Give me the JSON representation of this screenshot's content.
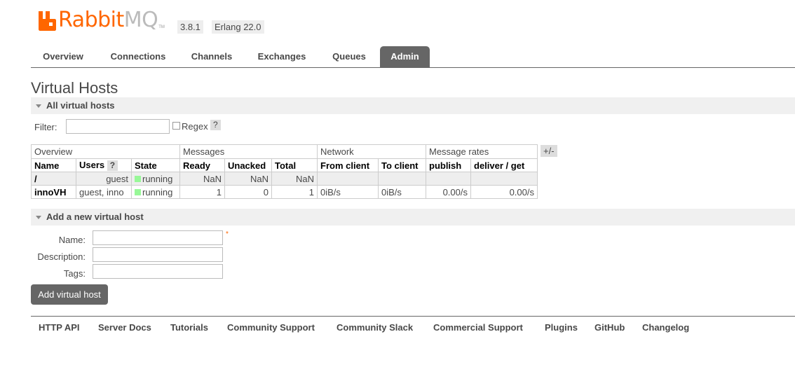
{
  "header": {
    "logo_text_primary": "Rabbit",
    "logo_text_secondary": "MQ",
    "logo_tm": "TM",
    "version": "3.8.1",
    "erlang": "Erlang 22.0",
    "brand_color": "#ff6600"
  },
  "tabs": [
    "Overview",
    "Connections",
    "Channels",
    "Exchanges",
    "Queues",
    "Admin"
  ],
  "active_tab": "Admin",
  "page_title": "Virtual Hosts",
  "all_vhosts": {
    "title": "All virtual hosts",
    "filter_label": "Filter:",
    "filter_value": "",
    "regex_label": "Regex",
    "help": "?"
  },
  "table": {
    "groups": [
      "Overview",
      "Messages",
      "Network",
      "Message rates"
    ],
    "columns": [
      "Name",
      "Users",
      "State",
      "Ready",
      "Unacked",
      "Total",
      "From client",
      "To client",
      "publish",
      "deliver / get"
    ],
    "users_help": "?",
    "plus_minus": "+/-",
    "rows": [
      {
        "name": "/",
        "users": "guest",
        "state": "running",
        "ready": "NaN",
        "unacked": "NaN",
        "total": "NaN",
        "from_client": "",
        "to_client": "",
        "publish": "",
        "deliver_get": ""
      },
      {
        "name": "innoVH",
        "users": "guest, inno",
        "state": "running",
        "ready": "1",
        "unacked": "0",
        "total": "1",
        "from_client": "0iB/s",
        "to_client": "0iB/s",
        "publish": "0.00/s",
        "deliver_get": "0.00/s"
      }
    ],
    "state_color": "#98f898"
  },
  "add_vhost": {
    "title": "Add a new virtual host",
    "name_label": "Name:",
    "description_label": "Description:",
    "tags_label": "Tags:",
    "required_mark": "*",
    "button": "Add virtual host"
  },
  "footer": [
    "HTTP API",
    "Server Docs",
    "Tutorials",
    "Community Support",
    "Community Slack",
    "Commercial Support",
    "Plugins",
    "GitHub",
    "Changelog"
  ]
}
